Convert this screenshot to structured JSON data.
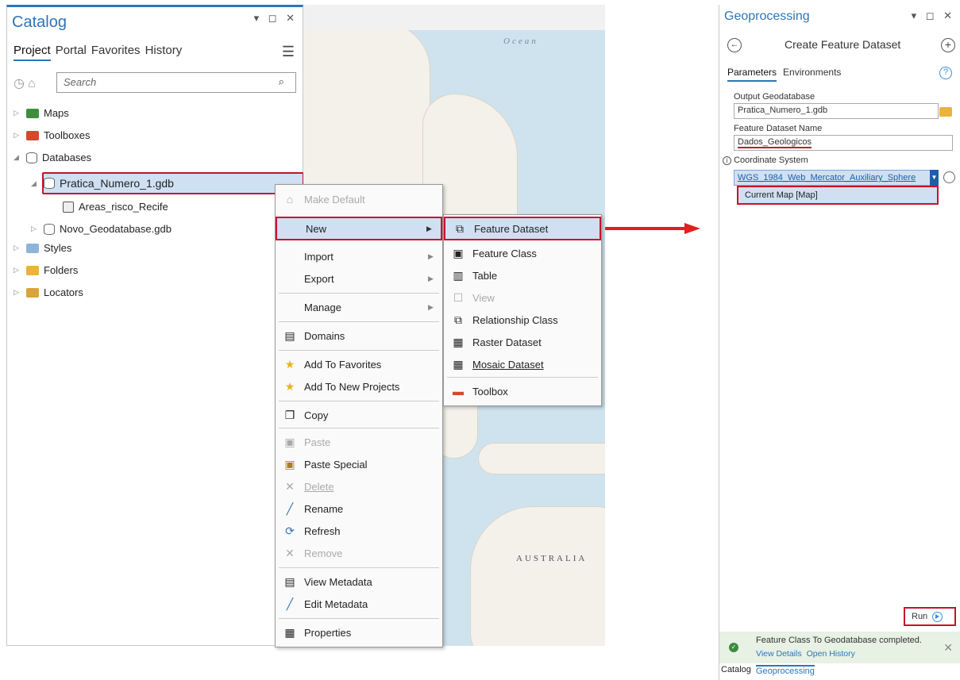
{
  "catalog": {
    "title": "Catalog",
    "tabs": [
      "Project",
      "Portal",
      "Favorites",
      "History"
    ],
    "search_placeholder": "Search",
    "tree": {
      "maps": "Maps",
      "toolboxes": "Toolboxes",
      "databases": "Databases",
      "gdb1": "Pratica_Numero_1.gdb",
      "fc1": "Areas_risco_Recife",
      "gdb2": "Novo_Geodatabase.gdb",
      "styles": "Styles",
      "folders": "Folders",
      "locators": "Locators"
    }
  },
  "map": {
    "ocean_label": "Ocean",
    "country_label": "AUSTRALIA"
  },
  "context_menu": {
    "make_default": "Make Default",
    "new": "New",
    "import": "Import",
    "export": "Export",
    "manage": "Manage",
    "domains": "Domains",
    "add_favorites": "Add To Favorites",
    "add_new_projects": "Add To New Projects",
    "copy": "Copy",
    "paste": "Paste",
    "paste_special": "Paste Special",
    "delete": "Delete",
    "rename": "Rename",
    "refresh": "Refresh",
    "remove": "Remove",
    "view_metadata": "View Metadata",
    "edit_metadata": "Edit Metadata",
    "properties": "Properties"
  },
  "submenu": {
    "feature_dataset": "Feature Dataset",
    "feature_class": "Feature Class",
    "table": "Table",
    "view": "View",
    "relationship_class": "Relationship Class",
    "raster_dataset": "Raster Dataset",
    "mosaic_dataset": "Mosaic Dataset",
    "toolbox": "Toolbox"
  },
  "geoprocessing": {
    "title": "Geoprocessing",
    "tool_name": "Create Feature Dataset",
    "tabs": [
      "Parameters",
      "Environments"
    ],
    "output_gdb_label": "Output Geodatabase",
    "output_gdb_value": "Pratica_Numero_1.gdb",
    "dataset_name_label": "Feature Dataset Name",
    "dataset_name_value": "Dados_Geologicos",
    "coord_label": "Coordinate System",
    "coord_value": "WGS_1984_Web_Mercator_Auxiliary_Sphere",
    "current_map": "Current Map [Map]",
    "run": "Run",
    "status_msg": "Feature Class To Geodatabase completed.",
    "view_details": "View Details",
    "open_history": "Open History",
    "bottom_tabs": [
      "Catalog",
      "Geoprocessing"
    ]
  },
  "colors": {
    "accent": "#2e75b6",
    "highlight_border": "#c8102e",
    "selection": "#cfe0f3"
  }
}
